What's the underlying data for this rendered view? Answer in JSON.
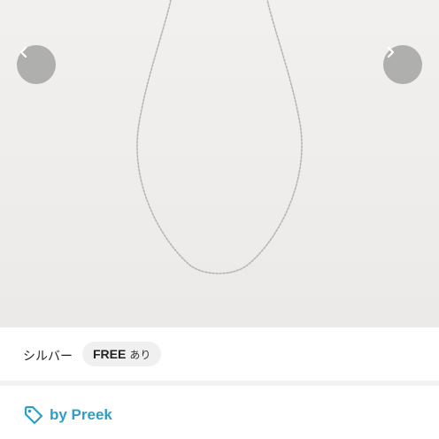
{
  "gallery": {
    "image_subject": "necklace-chain-photo",
    "prev_icon": "chevron-left-icon",
    "next_icon": "chevron-right-icon"
  },
  "variant": {
    "color": "シルバー",
    "size_name": "FREE",
    "size_stock": "あり"
  },
  "brand": {
    "icon": "tag-icon",
    "label": "by Preek",
    "color": "#2f9ec4"
  }
}
